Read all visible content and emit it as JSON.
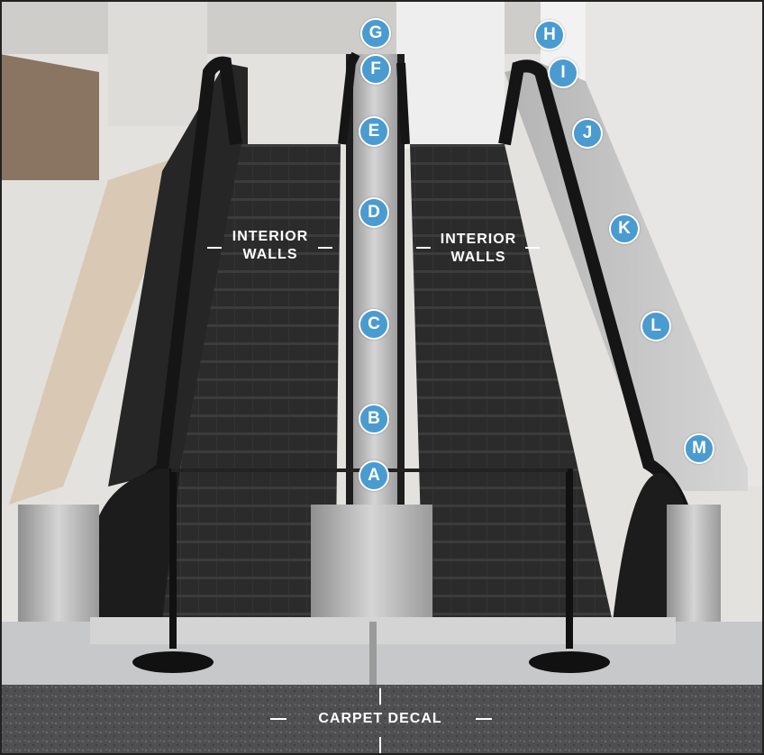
{
  "labels": {
    "interior_left": [
      "INTERIOR",
      "WALLS"
    ],
    "interior_right": [
      "INTERIOR",
      "WALLS"
    ],
    "carpet": "CARPET DECAL"
  },
  "markers": [
    "G",
    "H",
    "F",
    "I",
    "E",
    "J",
    "D",
    "K",
    "C",
    "L",
    "B",
    "M",
    "A"
  ],
  "colors": {
    "marker": "#4a9bd0",
    "handrail": "#1d1d1d",
    "steps": "#2a2a2a",
    "stainless": "#bdbdbd",
    "carpet": "#4d4d50",
    "wall": "#e9e7e3"
  }
}
